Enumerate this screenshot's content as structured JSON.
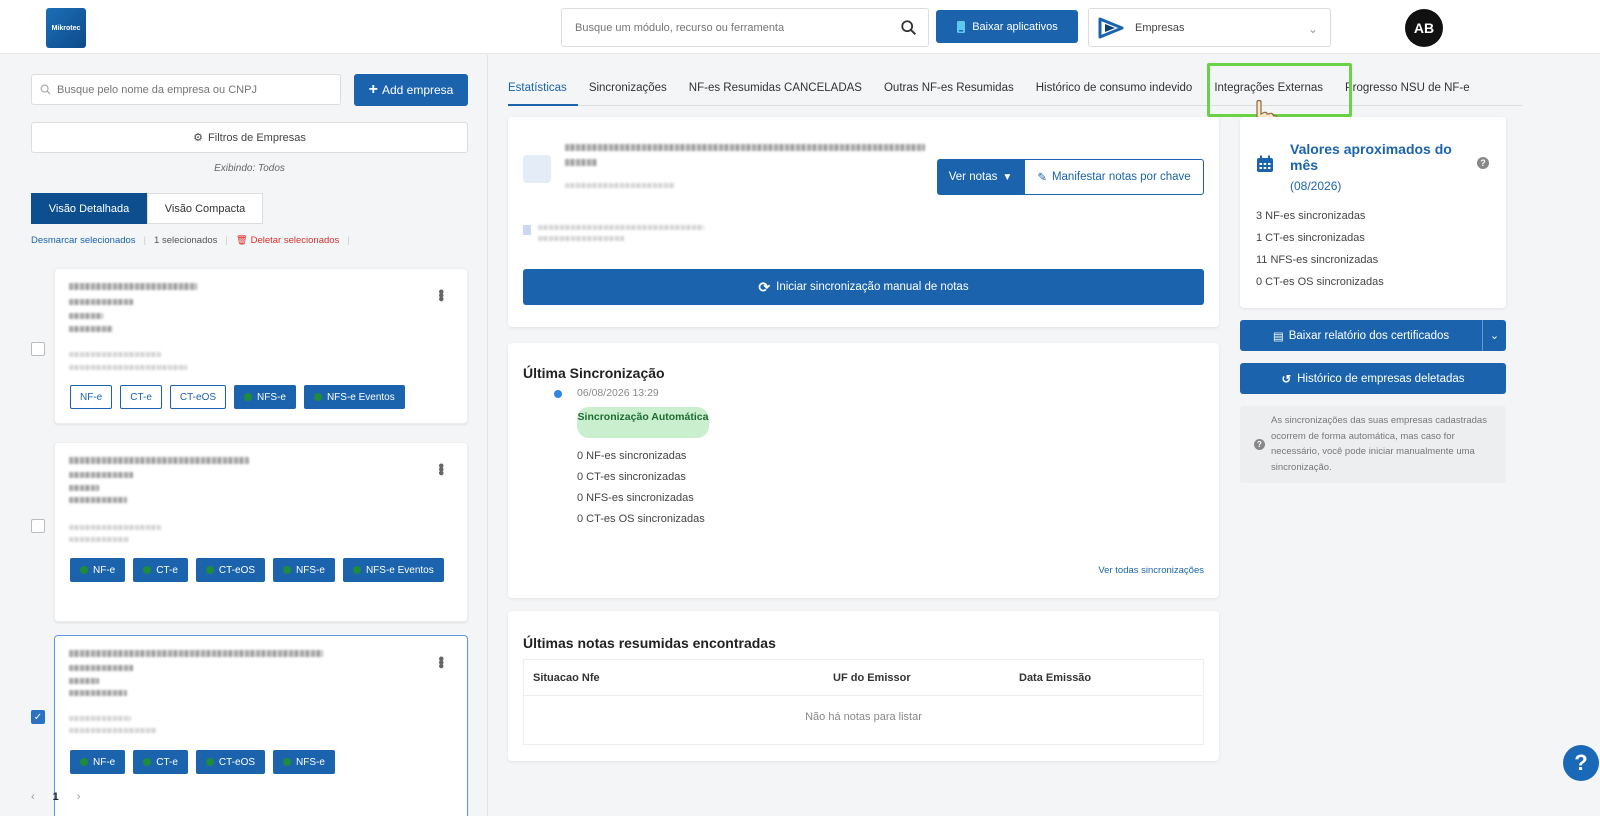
{
  "header": {
    "logo_text": "Mikrotec",
    "search_placeholder": "Busque um módulo, recurso ou ferramenta",
    "download_apps_label": "Baixar aplicativos",
    "company_selector_label": "Empresas",
    "avatar_initials": "AB"
  },
  "sidebar": {
    "search_placeholder": "Busque pelo nome da empresa ou CNPJ",
    "add_company_label": "Add empresa",
    "filters_label": "Filtros de Empresas",
    "showing_label": "Exibindo: Todos",
    "views": [
      "Visão Detalhada",
      "Visão Compacta"
    ],
    "active_view": "Visão Detalhada",
    "actions": {
      "deselect": "Desmarcar selecionados",
      "selected_count": "1 selecionados",
      "delete": "Deletar selecionados"
    },
    "cards": [
      {
        "selected": false,
        "chips": [
          {
            "label": "NF-e",
            "active": false
          },
          {
            "label": "CT-e",
            "active": false
          },
          {
            "label": "CT-eOS",
            "active": false
          },
          {
            "label": "NFS-e",
            "active": true
          },
          {
            "label": "NFS-e Eventos",
            "active": true
          }
        ]
      },
      {
        "selected": false,
        "chips": [
          {
            "label": "NF-e",
            "active": true
          },
          {
            "label": "CT-e",
            "active": true
          },
          {
            "label": "CT-eOS",
            "active": true
          },
          {
            "label": "NFS-e",
            "active": true
          },
          {
            "label": "NFS-e Eventos",
            "active": true
          }
        ]
      },
      {
        "selected": true,
        "chips": [
          {
            "label": "NF-e",
            "active": true
          },
          {
            "label": "CT-e",
            "active": true
          },
          {
            "label": "CT-eOS",
            "active": true
          },
          {
            "label": "NFS-e",
            "active": true
          }
        ]
      }
    ],
    "pagination": {
      "prev": "‹",
      "current": "1",
      "next": "›"
    }
  },
  "tabs": [
    {
      "label": "Estatísticas",
      "active": true
    },
    {
      "label": "Sincronizações",
      "active": false
    },
    {
      "label": "NF-es Resumidas CANCELADAS",
      "active": false
    },
    {
      "label": "Outras NF-es Resumidas",
      "active": false
    },
    {
      "label": "Histórico de consumo indevido",
      "active": false
    },
    {
      "label": "Integrações Externas",
      "active": false,
      "highlighted": true
    },
    {
      "label": "Progresso NSU de NF-e",
      "active": false
    }
  ],
  "company_panel": {
    "view_notes_label": "Ver notas",
    "manifest_label": "Manifestar notas por chave",
    "manual_sync_label": "Iniciar sincronização manual de notas"
  },
  "last_sync": {
    "title": "Última Sincronização",
    "datetime": "06/08/2026 13:29",
    "badge": "Sincronização Automática",
    "stats": [
      "0 NF-es sincronizadas",
      "0 CT-es sincronizadas",
      "0 NFS-es sincronizadas",
      "0 CT-es OS sincronizadas"
    ],
    "view_all_link": "Ver todas sincronizações"
  },
  "notes": {
    "title": "Últimas notas resumidas encontradas",
    "columns": [
      "Situacao Nfe",
      "UF do Emissor",
      "Data Emissão"
    ],
    "empty_message": "Não há notas para listar"
  },
  "monthly_values": {
    "title": "Valores aproximados do mês",
    "period": "(08/2026)",
    "items": [
      "3 NF-es sincronizadas",
      "1 CT-es sincronizadas",
      "11 NFS-es sincronizadas",
      "0 CT-es OS sincronizadas"
    ]
  },
  "right_actions": {
    "certificates_report_label": "Baixar relatório dos certificados",
    "deleted_history_label": "Histórico de empresas deletadas",
    "info_text": "As sincronizações das suas empresas cadastradas ocorrem de forma automática, mas caso for necessário, você pode iniciar manualmente uma sincronização."
  },
  "help_fab_label": "?",
  "colors": {
    "primary": "#1b64ad",
    "primary_dark": "#0d4f8e",
    "highlight": "#6ad247",
    "success_bg": "#c9efcf",
    "danger": "#d9322c"
  }
}
